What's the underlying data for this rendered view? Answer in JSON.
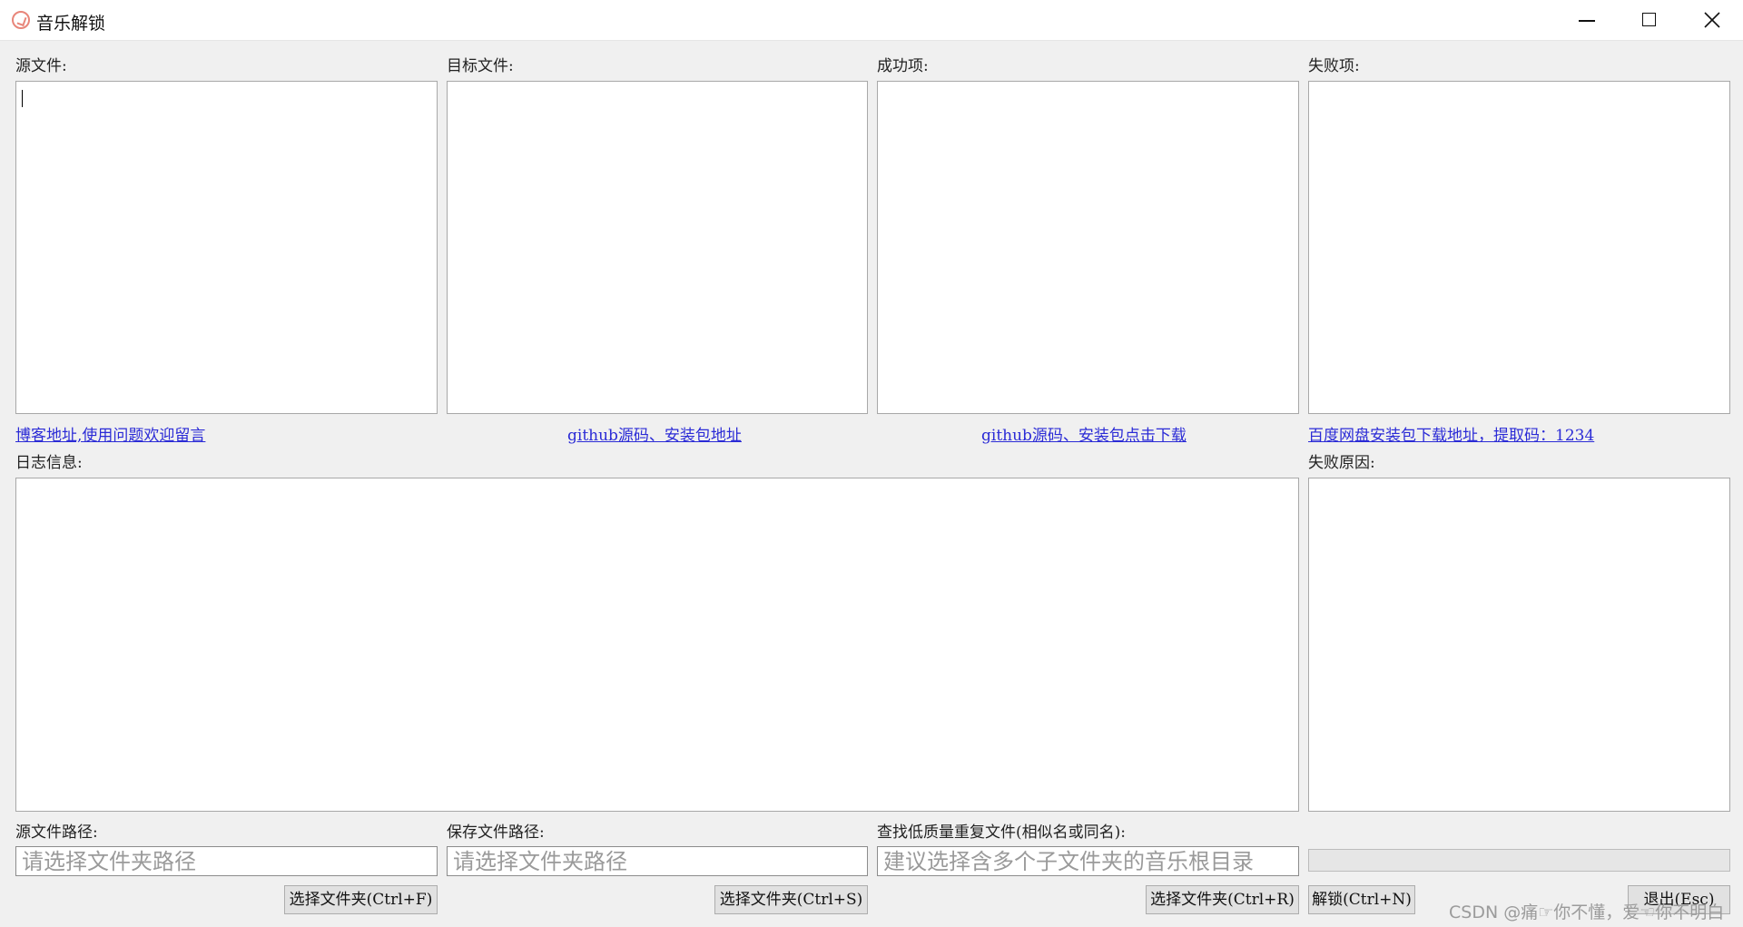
{
  "window": {
    "title": "音乐解锁",
    "icon": "app-logo-icon",
    "controls": [
      "minimize-icon",
      "maximize-icon",
      "close-icon"
    ]
  },
  "panels": {
    "source_files": {
      "label": "源文件:"
    },
    "target_files": {
      "label": "目标文件:"
    },
    "success_items": {
      "label": "成功项:"
    },
    "failed_items": {
      "label": "失败项:"
    },
    "log": {
      "label": "日志信息:"
    },
    "fail_reason": {
      "label": "失败原因:"
    }
  },
  "links": {
    "blog": "博客地址,使用问题欢迎留言",
    "github_repo": "github源码、安装包地址",
    "github_download": "github源码、安装包点击下载",
    "baidu_pan": "百度网盘安装包下载地址，提取码：1234"
  },
  "paths": {
    "source": {
      "label": "源文件路径:",
      "value": "",
      "placeholder": "请选择文件夹路径"
    },
    "save": {
      "label": "保存文件路径:",
      "value": "",
      "placeholder": "请选择文件夹路径"
    },
    "dup": {
      "label": "查找低质量重复文件(相似名或同名):",
      "value": "",
      "placeholder": "建议选择含多个子文件夹的音乐根目录"
    }
  },
  "progress": 0,
  "buttons": {
    "select_source": "选择文件夹(Ctrl+F)",
    "select_save": "选择文件夹(Ctrl+S)",
    "select_dup": "选择文件夹(Ctrl+R)",
    "unlock": "解锁(Ctrl+N)",
    "exit": "退出(Esc)"
  },
  "watermark": "CSDN @痛☞你不懂，爱☜你不明白",
  "colors": {
    "link": "#2b2bd6",
    "background": "#f0f0f0"
  }
}
